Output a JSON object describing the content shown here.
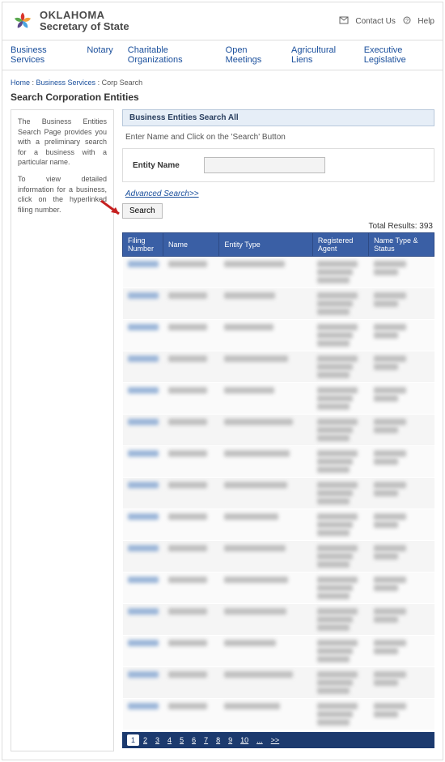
{
  "header": {
    "brand_line1": "OKLAHOMA",
    "brand_line2": "Secretary of State",
    "contact_label": "Contact Us",
    "help_label": "Help"
  },
  "nav": {
    "items": [
      "Business Services",
      "Notary",
      "Charitable Organizations",
      "Open Meetings",
      "Agricultural Liens",
      "Executive Legislative"
    ]
  },
  "breadcrumb": {
    "home": "Home",
    "bs": "Business Services",
    "cur": "Corp Search"
  },
  "page_title": "Search Corporation Entities",
  "sidebar": {
    "p1": "The Business Entities Search Page provides you with a preliminary search for a business with a particular name.",
    "p2": "To view detailed information for a business, click on the hyperlinked filing number."
  },
  "panel": {
    "title": "Business Entities Search All",
    "instruction": "Enter Name and Click on the 'Search' Button",
    "entity_name_label": "Entity Name",
    "entity_name_value": "",
    "adv_link": "Advanced Search>>",
    "search_btn": "Search"
  },
  "results": {
    "total_label": "Total Results: 393",
    "columns": [
      "Filing Number",
      "Name",
      "Entity Type",
      "Registered Agent",
      "Name Type & Status"
    ],
    "row_count": 15
  },
  "pager": {
    "pages": [
      "1",
      "2",
      "3",
      "4",
      "5",
      "6",
      "7",
      "8",
      "9",
      "10",
      "...",
      ">>"
    ],
    "current": "1"
  }
}
